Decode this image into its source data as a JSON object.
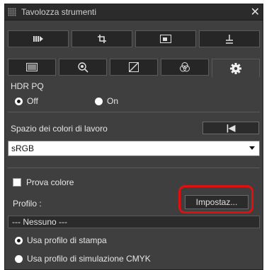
{
  "window": {
    "title": "Tavolozza strumenti",
    "close_glyph": "✕"
  },
  "tabs_row1": [
    {
      "icon": "tone-curve-adjust-icon"
    },
    {
      "icon": "crop-icon"
    },
    {
      "icon": "image-icon"
    },
    {
      "icon": "level-stamp-icon"
    }
  ],
  "tabs_row2": [
    {
      "icon": "basic-adjust-icon"
    },
    {
      "icon": "lens-correction-icon"
    },
    {
      "icon": "tone-curve-icon"
    },
    {
      "icon": "color-adjust-icon"
    },
    {
      "icon": "settings-gear-icon",
      "active": true
    }
  ],
  "hdr_pq": {
    "label": "HDR PQ",
    "options": [
      {
        "label": "Off",
        "selected": true
      },
      {
        "label": "On",
        "selected": false
      }
    ]
  },
  "color_space": {
    "label": "Spazio dei colori di lavoro",
    "reset_glyph": "|◀",
    "value": "sRGB"
  },
  "proof": {
    "checkbox_label": "Prova colore",
    "checked": false,
    "profile_label": "Profilo :",
    "settings_button": "Impostaz...",
    "profile_value": "--- Nessuno ---"
  },
  "profile_options": [
    {
      "label": "Usa profilo di stampa",
      "selected": true
    },
    {
      "label": "Usa profilo di simulazione CMYK",
      "selected": false
    }
  ],
  "colors": {
    "panel_bg": "#3f3f3f",
    "highlight": "#e01010"
  }
}
